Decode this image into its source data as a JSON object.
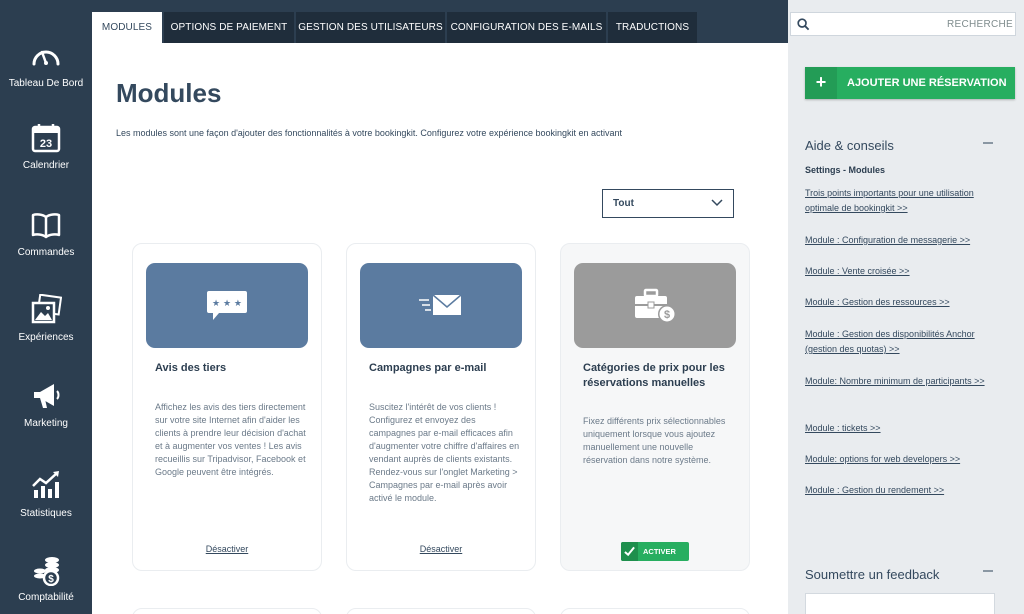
{
  "sidebar": {
    "items": [
      {
        "label": "Tableau De Bord",
        "icon": "dashboard-gauge-icon"
      },
      {
        "label": "Calendrier",
        "icon": "calendar-icon",
        "day": "23"
      },
      {
        "label": "Commandes",
        "icon": "book-icon"
      },
      {
        "label": "Expériences",
        "icon": "photos-icon"
      },
      {
        "label": "Marketing",
        "icon": "megaphone-icon"
      },
      {
        "label": "Statistiques",
        "icon": "chart-growth-icon"
      },
      {
        "label": "Comptabilité",
        "icon": "coins-icon"
      }
    ]
  },
  "tabs": [
    {
      "label": "MODULES",
      "active": true
    },
    {
      "label": "OPTIONS DE PAIEMENT",
      "active": false
    },
    {
      "label": "GESTION DES UTILISATEURS",
      "active": false
    },
    {
      "label": "CONFIGURATION DES E-MAILS",
      "active": false
    },
    {
      "label": "TRADUCTIONS",
      "active": false
    }
  ],
  "main": {
    "title": "Modules",
    "description": "Les modules sont une façon d'ajouter des fonctionnalités à votre bookingkit. Configurez votre expérience bookingkit en activant",
    "filter": {
      "selected": "Tout"
    },
    "cards": [
      {
        "title": "Avis des tiers",
        "description": "Affichez les avis des tiers directement sur votre site Internet afin d'aider les clients à prendre leur décision d'achat et à augmenter vos ventes ! Les avis recueillis sur Tripadvisor, Facebook et Google peuvent être intégrés.",
        "action": "Désactiver",
        "icon": "review-bubble-icon",
        "color": "#5b7ba0"
      },
      {
        "title": "Campagnes par e-mail",
        "description": "Suscitez l'intérêt de vos clients ! Configurez et envoyez des campagnes par e-mail efficaces afin d'augmenter votre chiffre d'affaires en vendant auprès de clients existants. Rendez-vous sur l'onglet Marketing > Campagnes par e-mail après avoir activé le module.",
        "action": "Désactiver",
        "icon": "email-fast-icon",
        "color": "#5b7ba0"
      },
      {
        "title": "Catégories de prix pour les réservations manuelles",
        "description": "Fixez différents prix sélectionnables uniquement lorsque vous ajoutez manuellement une nouvelle réservation dans notre système.",
        "action": "ACTIVER",
        "icon": "briefcase-dollar-icon",
        "color": "#9b9b9b"
      }
    ]
  },
  "right_panel": {
    "search_placeholder": "RECHERCHE",
    "add_button": "AJOUTER UNE RÉSERVATION",
    "help_title": "Aide & conseils",
    "help_subtitle": "Settings - Modules",
    "help_links": [
      "Trois points importants pour une utilisation optimale de bookingkit >>",
      "Module : Configuration de messagerie >>",
      "Module : Vente croisée >>",
      "Module : Gestion des ressources >>",
      "Module : Gestion des disponibilités Anchor (gestion des quotas) >>",
      "Module: Nombre minimum de participants >>",
      "Module : tickets >>",
      "Module: options for web developers >>",
      "Module : Gestion du rendement >>"
    ],
    "feedback_title": "Soumettre un feedback"
  },
  "colors": {
    "sidebar": "#2c3e50",
    "accent_green": "#27ae60",
    "card_banner_active": "#5b7ba0",
    "card_banner_inactive": "#9b9b9b",
    "panel": "#e9ecef"
  }
}
